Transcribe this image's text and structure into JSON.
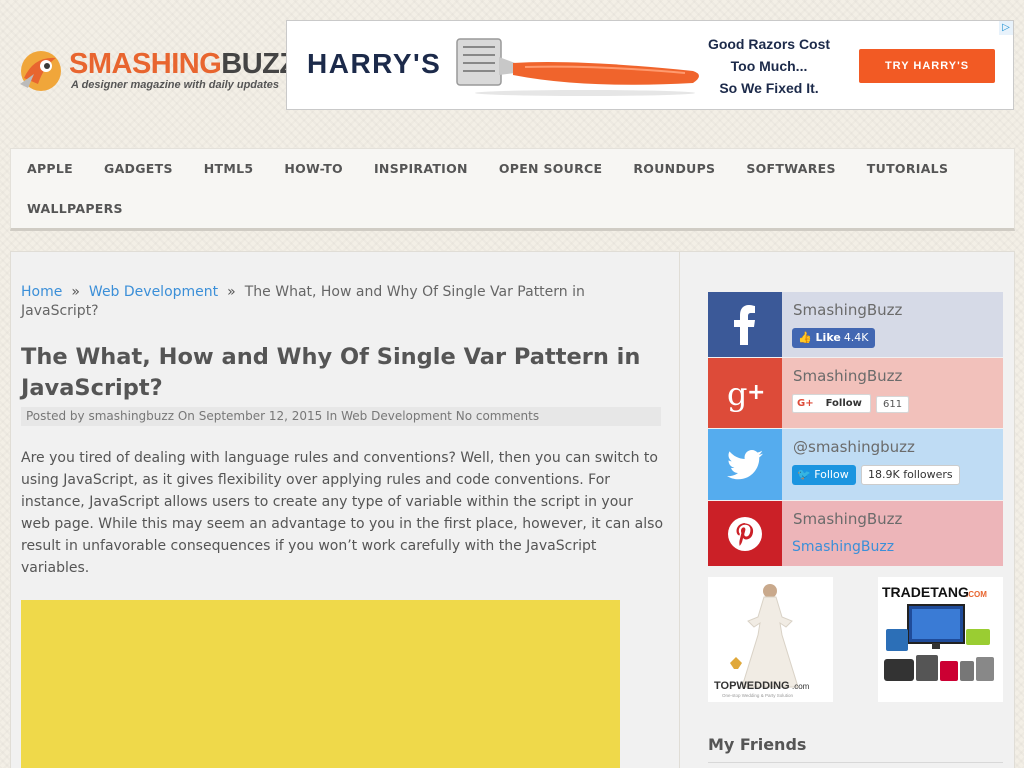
{
  "site": {
    "logo_name_part1": "SMASHING",
    "logo_name_part2": "BUZZ",
    "tagline": "A designer magazine with daily updates"
  },
  "ad_banner": {
    "brand": "HARRY'S",
    "copy_line1": "Good Razors Cost",
    "copy_line2": "Too Much...",
    "copy_line3": "So We Fixed It.",
    "cta": "TRY HARRY'S",
    "adchoices": "▷"
  },
  "nav": {
    "items": [
      "APPLE",
      "GADGETS",
      "HTML5",
      "HOW-TO",
      "INSPIRATION",
      "OPEN SOURCE",
      "ROUNDUPS",
      "SOFTWARES",
      "TUTORIALS",
      "WALLPAPERS"
    ]
  },
  "breadcrumb": {
    "home": "Home",
    "separator": "»",
    "category": "Web Development",
    "current": "The What, How and Why Of Single Var Pattern in JavaScript?"
  },
  "post": {
    "title": "The What, How and Why Of Single Var Pattern in JavaScript?",
    "meta": {
      "posted_by_label": "Posted by",
      "author": "smashingbuzz",
      "on_label": "On",
      "date": "September 12, 2015",
      "in_label": "In",
      "category": "Web Development",
      "comments": "No comments"
    },
    "intro": "Are you tired of dealing with language rules and conventions? Well, then you can switch to using JavaScript, as it gives flexibility over applying rules and code conventions. For instance, JavaScript allows users to create any type of variable within the script in your web page. While this may seem an advantage to you in the first place, however, it can also result in unfavorable consequences if you won’t work carefully with the JavaScript variables."
  },
  "sidebar": {
    "facebook": {
      "name": "SmashingBuzz",
      "like_label": "Like",
      "like_count": "4.4K",
      "icon": "facebook-icon",
      "color": "#3b5998",
      "bg": "#d6dae7"
    },
    "googleplus": {
      "name": "SmashingBuzz",
      "follow_label": "Follow",
      "count": "611",
      "icon": "google-plus-icon",
      "color": "#dd4b39",
      "bg": "#f2c1bb"
    },
    "twitter": {
      "name": "@smashingbuzz",
      "follow_label": "Follow",
      "followers": "18.9K followers",
      "icon": "twitter-icon",
      "color": "#55acee",
      "bg": "#bfdcf4"
    },
    "pinterest": {
      "name": "SmashingBuzz",
      "link": "SmashingBuzz",
      "icon": "pinterest-icon",
      "color": "#cb2027",
      "bg": "#edb5b9"
    },
    "ads": [
      {
        "brand": "TOPWEDDING",
        "brand_suffix": ".com",
        "tag": "One-stop Wedding & Party Solution"
      },
      {
        "brand": "TRADETANG",
        "brand_suffix": ".COM"
      }
    ],
    "friends_heading": "My Friends"
  }
}
